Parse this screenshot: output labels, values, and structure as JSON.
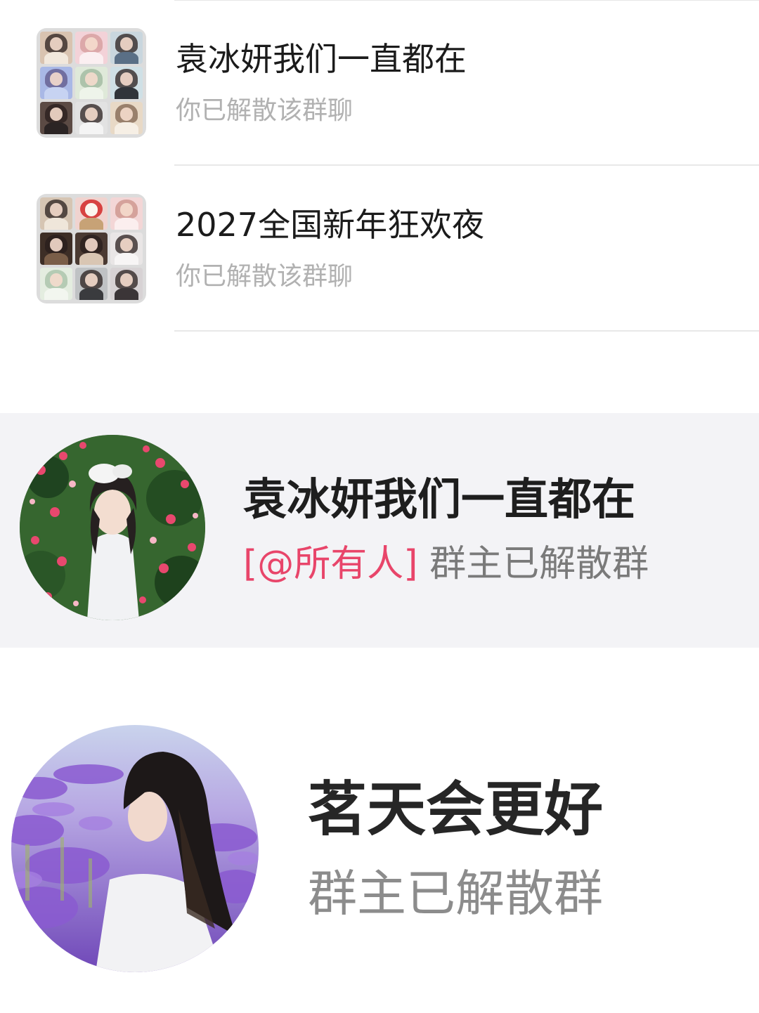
{
  "chat_list": [
    {
      "title": "袁冰妍我们一直都在",
      "subtitle": "你已解散该群聊",
      "avatar": "group-grid-avatar"
    },
    {
      "title": "2027全国新年狂欢夜",
      "subtitle": "你已解散该群聊",
      "avatar": "group-grid-avatar"
    },
    {
      "title": "袁冰妍我们一直都在",
      "mention": "[@所有人]",
      "subtitle": "群主已解散群",
      "avatar": "rose-garden-portrait"
    },
    {
      "title": "茗天会更好",
      "subtitle": "群主已解散群",
      "avatar": "lavender-field-portrait"
    }
  ],
  "colors": {
    "background": "#ffffff",
    "highlight_row": "#f3f3f6",
    "title": "#1b1b1b",
    "subtitle": "#b1b1b1",
    "mention": "#e8456a"
  }
}
